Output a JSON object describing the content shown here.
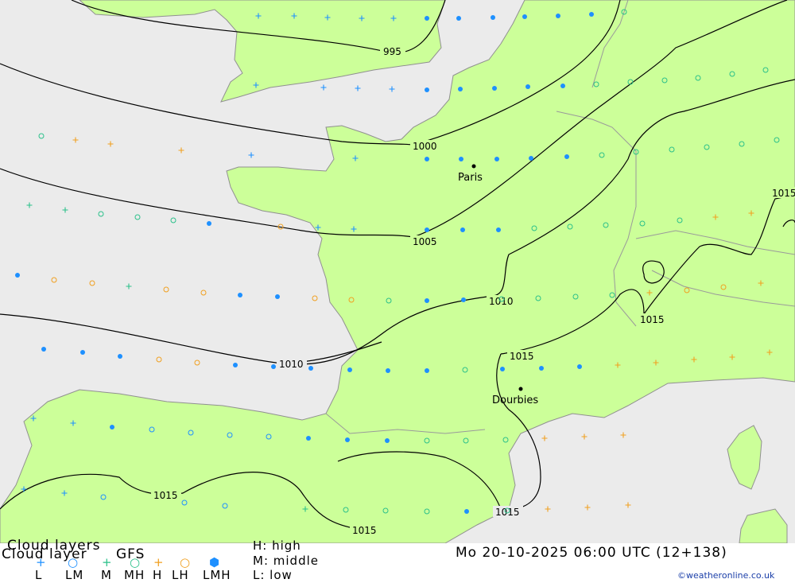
{
  "map": {
    "colors": {
      "sea": "#ebebeb",
      "land": "#ccff99",
      "isobar": "#000000",
      "border": "#9a9a9a"
    },
    "cities": [
      {
        "name": "Paris"
      },
      {
        "name": "Dourbies"
      }
    ],
    "isobars": [
      {
        "value": "995"
      },
      {
        "value": "1000"
      },
      {
        "value": "1005"
      },
      {
        "value": "1010"
      },
      {
        "value": "1010"
      },
      {
        "value": "1015"
      },
      {
        "value": "1015"
      },
      {
        "value": "1015"
      },
      {
        "value": "1015"
      },
      {
        "value": "1015"
      },
      {
        "value": "1015"
      }
    ],
    "symbol_colors": {
      "low": "#1e90ff",
      "middle": "#2bc08a",
      "high": "#f0a020"
    }
  },
  "legend": {
    "title_back": "Cloud layers",
    "title_front": "Cloud layer",
    "model": "GFS",
    "high_label": "H: high",
    "middle_label": "M: middle",
    "low_label": "L: low",
    "categories": [
      "L",
      "LM",
      "M",
      "MH",
      "H",
      "LH",
      "LMH"
    ],
    "symbols": [
      {
        "name": "L",
        "glyph": "+",
        "color": "#1e90ff",
        "icon": "plus-icon"
      },
      {
        "name": "LM",
        "glyph": "○",
        "color": "#1e90ff",
        "icon": "ring-icon"
      },
      {
        "name": "M",
        "glyph": "+",
        "color": "#2bc08a",
        "icon": "plus-icon"
      },
      {
        "name": "MH",
        "glyph": "○",
        "color": "#2bc08a",
        "icon": "ring-icon"
      },
      {
        "name": "H",
        "glyph": "+",
        "color": "#f0a020",
        "icon": "plus-icon"
      },
      {
        "name": "LH",
        "glyph": "○",
        "color": "#f0a020",
        "icon": "ring-icon"
      },
      {
        "name": "LMH",
        "glyph": "⬢",
        "color": "#1e90ff",
        "icon": "hexagon-icon"
      }
    ],
    "datetime": "Mo 20-10-2025 06:00 UTC (12+138)",
    "credit": "©weatheronline.co.uk"
  }
}
